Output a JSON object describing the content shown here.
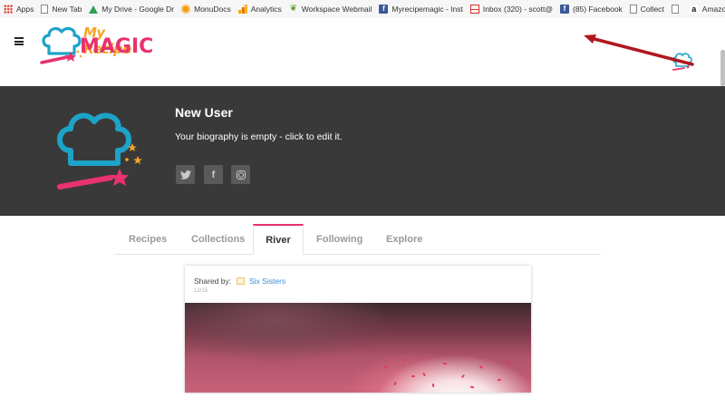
{
  "bookmarks": [
    {
      "label": "Apps",
      "icon": "apps-grid-icon"
    },
    {
      "label": "New Tab",
      "icon": "page-icon"
    },
    {
      "label": "My Drive - Google Dr",
      "icon": "google-drive-icon"
    },
    {
      "label": "MonuDocs",
      "icon": "monudocs-icon"
    },
    {
      "label": "Analytics",
      "icon": "analytics-icon"
    },
    {
      "label": "Workspace Webmail",
      "icon": "webmail-icon"
    },
    {
      "label": "Myrecipemagic - Inst",
      "icon": "facebook-icon"
    },
    {
      "label": "Inbox (320) - scott@",
      "icon": "gmail-icon"
    },
    {
      "label": "(85) Facebook",
      "icon": "facebook-icon"
    },
    {
      "label": "Collect",
      "icon": "page-icon"
    },
    {
      "label": "",
      "icon": "page-icon"
    },
    {
      "label": "Amazon.com Associa",
      "icon": "amazon-icon"
    }
  ],
  "header": {
    "logo_top": "My Recipe",
    "logo_bottom": "MAGIC"
  },
  "profile": {
    "name": "New User",
    "bio": "Your biography is empty - click to edit it.",
    "social": {
      "twitter": "twitter-icon",
      "facebook": "f",
      "instagram": "instagram-icon"
    }
  },
  "tabs": [
    {
      "label": "Recipes",
      "active": false
    },
    {
      "label": "Collections",
      "active": false
    },
    {
      "label": "River",
      "active": true
    },
    {
      "label": "Following",
      "active": false
    },
    {
      "label": "Explore",
      "active": false
    }
  ],
  "feed": {
    "shared_by_label": "Shared by:",
    "shared_by_name": "Six Sisters",
    "date": "12/15"
  },
  "colors": {
    "brand_pink": "#e8336e",
    "brand_orange": "#f5a623",
    "brand_teal": "#1ea3c8",
    "banner_bg": "#3a3939",
    "link_blue": "#3b8ed5"
  }
}
